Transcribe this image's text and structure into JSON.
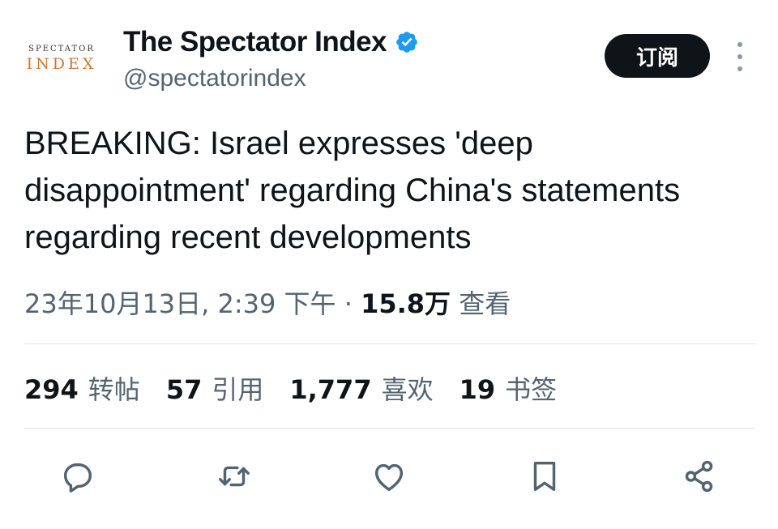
{
  "account": {
    "avatar_line1": "SPECTATOR",
    "avatar_line2": "INDEX",
    "display_name": "The Spectator Index",
    "handle": "@spectatorindex",
    "verified": true
  },
  "header": {
    "subscribe_label": "订阅"
  },
  "tweet": {
    "text": "BREAKING: Israel expresses 'deep disappointment' regarding China's statements regarding recent developments",
    "timestamp": "23年10月13日, 2:39 下午",
    "separator": "·",
    "views_count": "15.8万",
    "views_label": "查看"
  },
  "stats": [
    {
      "count": "294",
      "label": "转帖"
    },
    {
      "count": "57",
      "label": "引用"
    },
    {
      "count": "1,777",
      "label": "喜欢"
    },
    {
      "count": "19",
      "label": "书签"
    }
  ],
  "actions": [
    {
      "icon": "reply-icon"
    },
    {
      "icon": "retweet-icon"
    },
    {
      "icon": "like-icon"
    },
    {
      "icon": "bookmark-icon"
    },
    {
      "icon": "share-icon"
    }
  ],
  "colors": {
    "text": "#0f1419",
    "secondary": "#536471",
    "verified": "#1d9bf0",
    "button_bg": "#0f1419",
    "brand_accent": "#c8793a"
  }
}
